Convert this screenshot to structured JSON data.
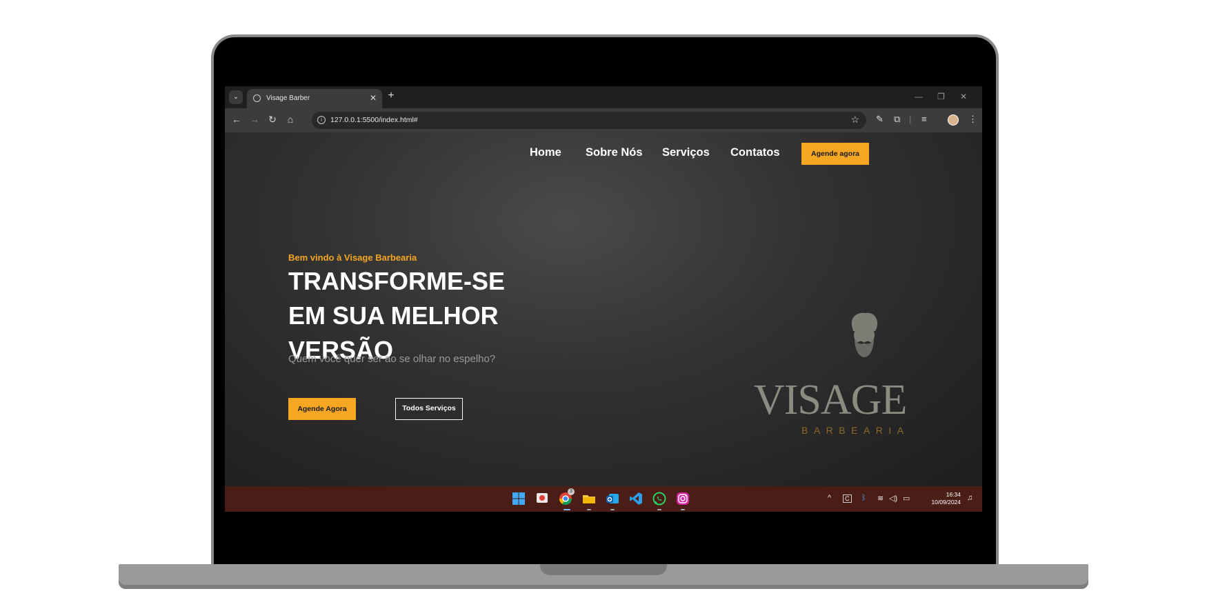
{
  "browser": {
    "tab_title": "Visage Barber",
    "url": "127.0.0.1:5500/index.html#"
  },
  "site": {
    "nav": {
      "home": "Home",
      "about": "Sobre Nós",
      "services": "Serviços",
      "contacts": "Contatos",
      "cta": "Agende agora"
    },
    "hero": {
      "welcome": "Bem vindo à Visage Barbearia",
      "headline": "TRANSFORME-SE EM SUA MELHOR VERSÃO",
      "subtitle": "Quem você quer ser ao se olhar no espelho?",
      "primary_button": "Agende Agora",
      "secondary_button": "Todos Serviços"
    },
    "logo": {
      "wordmark": "VISAGE",
      "tagline": "BARBEARIA"
    }
  },
  "taskbar": {
    "time": "16:34",
    "date": "10/09/2024",
    "chrome_badge": "3"
  },
  "colors": {
    "accent": "#f5a623",
    "taskbar": "#4a1e16"
  }
}
